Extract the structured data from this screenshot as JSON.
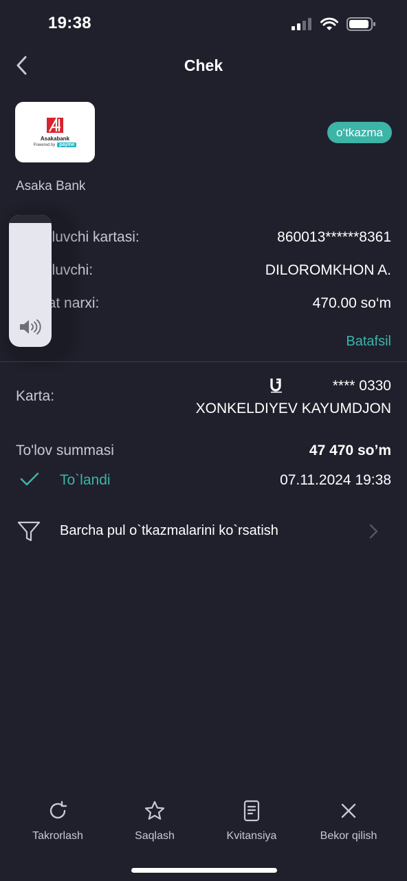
{
  "status_bar": {
    "time": "19:38"
  },
  "header": {
    "title": "Chek"
  },
  "bank": {
    "logo_name": "Asakabank",
    "logo_powered": "Powered by",
    "logo_brand": "payme",
    "name": "Asaka Bank",
    "type_badge": "o‘tkazma"
  },
  "details": [
    {
      "label": "Pul qiluvchi kartasi:",
      "value": "860013******8361"
    },
    {
      "label": "Pul qiluvchi:",
      "value": "DILOROMKHON A."
    },
    {
      "label": "Xizmat narxi:",
      "value": "470.00 so‘m"
    }
  ],
  "details_link": "Batafsil",
  "card": {
    "label": "Karta:",
    "number": "**** 0330",
    "holder": "XONKELDIYEV KAYUMDJON"
  },
  "payment": {
    "label": "To'lov summasi",
    "amount": "47 470 so’m",
    "status": "To`landi",
    "datetime": "07.11.2024 19:38"
  },
  "filter": {
    "label": "Barcha pul o`tkazmalarini ko`rsatish"
  },
  "tabs": [
    {
      "label": "Takrorlash",
      "icon": "repeat-icon"
    },
    {
      "label": "Saqlash",
      "icon": "star-icon"
    },
    {
      "label": "Kvitansiya",
      "icon": "receipt-icon"
    },
    {
      "label": "Bekor qilish",
      "icon": "close-icon"
    }
  ],
  "colors": {
    "background": "#20202c",
    "accent": "#3cb4a8",
    "muted_text": "#c8c9d2"
  }
}
